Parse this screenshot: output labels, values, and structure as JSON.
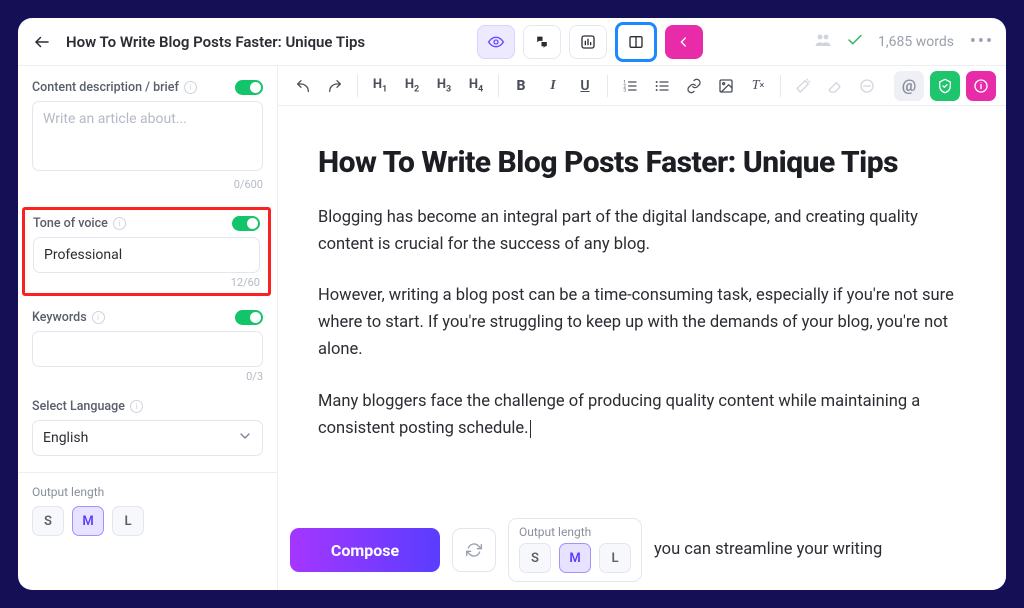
{
  "topbar": {
    "title": "How To Write Blog Posts Faster: Unique Tips",
    "word_count": "1,685 words"
  },
  "sidebar": {
    "brief": {
      "label": "Content description / brief",
      "placeholder": "Write an article about...",
      "value": "",
      "counter": "0/600"
    },
    "tone": {
      "label": "Tone of voice",
      "value": "Professional",
      "counter": "12/60"
    },
    "keywords": {
      "label": "Keywords",
      "value": "",
      "counter": "0/3"
    },
    "language": {
      "label": "Select Language",
      "value": "English"
    },
    "output_length": {
      "label": "Output length",
      "options": [
        "S",
        "M",
        "L"
      ],
      "selected": "M"
    }
  },
  "toolbar": {
    "headings": [
      "1",
      "2",
      "3",
      "4"
    ]
  },
  "document": {
    "title": "How To Write Blog Posts Faster: Unique Tips",
    "para1": "Blogging has become an integral part of the digital landscape, and creating quality content is crucial for the success of any blog.",
    "para2": "However, writing a blog post can be a time-consuming task, especially if you're not sure where to start. If you're struggling to keep up with the demands of your blog, you're not alone.",
    "para3": "Many bloggers face the challenge of producing quality content while maintaining a consistent posting schedule.",
    "tail": "you can streamline your writing"
  },
  "compose": {
    "button": "Compose",
    "output_length": {
      "label": "Output length",
      "options": [
        "S",
        "M",
        "L"
      ],
      "selected": "M"
    }
  }
}
